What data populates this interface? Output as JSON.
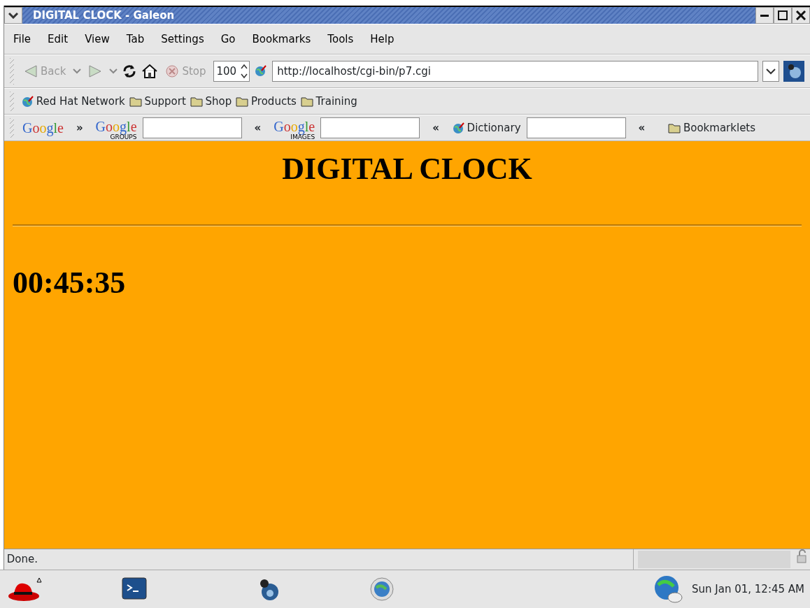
{
  "window": {
    "title": "DIGITAL CLOCK - Galeon"
  },
  "menu": [
    "File",
    "Edit",
    "View",
    "Tab",
    "Settings",
    "Go",
    "Bookmarks",
    "Tools",
    "Help"
  ],
  "toolbar": {
    "back": {
      "label": "Back",
      "disabled": true
    },
    "forward": {
      "disabled": true
    },
    "stop": {
      "label": "Stop",
      "disabled": true
    },
    "zoom": "100",
    "url": "http://localhost/cgi-bin/p7.cgi"
  },
  "bookmarks": [
    {
      "kind": "site",
      "label": "Red Hat Network"
    },
    {
      "kind": "folder",
      "label": "Support"
    },
    {
      "kind": "folder",
      "label": "Shop"
    },
    {
      "kind": "folder",
      "label": "Products"
    },
    {
      "kind": "folder",
      "label": "Training"
    }
  ],
  "search_bar": [
    {
      "kind": "logo",
      "label": "Google"
    },
    {
      "kind": "chevron",
      "label": "»"
    },
    {
      "kind": "logo",
      "label": "Google",
      "sub": "GROUPS"
    },
    {
      "kind": "field"
    },
    {
      "kind": "chevron",
      "label": "«"
    },
    {
      "kind": "logo",
      "label": "Google",
      "sub": "IMAGES"
    },
    {
      "kind": "field"
    },
    {
      "kind": "chevron",
      "label": "«"
    },
    {
      "kind": "site",
      "label": "Dictionary"
    },
    {
      "kind": "field"
    },
    {
      "kind": "chevron",
      "label": "«"
    },
    {
      "kind": "folder",
      "label": "Bookmarklets"
    }
  ],
  "page": {
    "heading": "DIGITAL CLOCK",
    "time": "00:45:35"
  },
  "status_bar": {
    "text": "Done."
  },
  "taskbar": {
    "clock": "Sun Jan 01, 12:45 AM"
  }
}
